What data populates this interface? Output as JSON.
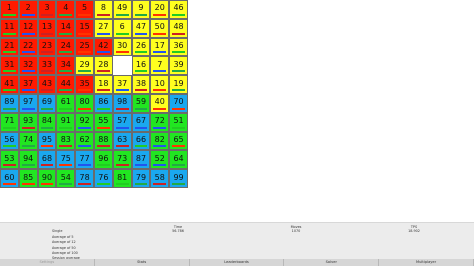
{
  "board": {
    "rows": [
      [
        1,
        2,
        3,
        4,
        5,
        8,
        49,
        9,
        20,
        46
      ],
      [
        11,
        12,
        13,
        14,
        15,
        27,
        6,
        47,
        50,
        48
      ],
      [
        21,
        22,
        23,
        24,
        25,
        "42",
        30,
        26,
        17,
        36
      ],
      [
        31,
        32,
        33,
        34,
        29,
        28,
        null,
        16,
        7,
        39
      ],
      [
        41,
        "37",
        43,
        44,
        "35",
        18,
        37,
        38,
        10,
        19
      ],
      [
        89,
        97,
        69,
        61,
        80,
        86,
        98,
        59,
        40,
        70
      ],
      [
        71,
        93,
        84,
        91,
        92,
        55,
        57,
        67,
        72,
        51
      ],
      [
        56,
        74,
        95,
        83,
        62,
        88,
        63,
        66,
        82,
        65
      ],
      [
        53,
        94,
        68,
        75,
        77,
        96,
        73,
        87,
        52,
        64
      ],
      [
        60,
        85,
        90,
        54,
        78,
        76,
        81,
        79,
        58,
        99
      ]
    ],
    "cell_colors": [
      [
        "red",
        "red",
        "red",
        "red",
        "red",
        "yellow",
        "yellow",
        "yellow",
        "yellow",
        "yellow"
      ],
      [
        "red",
        "red",
        "red",
        "red",
        "red",
        "yellow",
        "yellow",
        "yellow",
        "yellow",
        "yellow"
      ],
      [
        "red",
        "red",
        "red",
        "red",
        "red",
        "red",
        "yellow",
        "yellow",
        "yellow",
        "yellow"
      ],
      [
        "red",
        "red",
        "red",
        "red",
        "yellow",
        "yellow",
        "blank",
        "yellow",
        "yellow",
        "yellow"
      ],
      [
        "red",
        "red",
        "red",
        "red",
        "red",
        "yellow",
        "yellow",
        "yellow",
        "yellow",
        "yellow"
      ],
      [
        "blue",
        "blue",
        "blue",
        "green",
        "green",
        "blue",
        "blue",
        "green",
        "yellow",
        "blue"
      ],
      [
        "green",
        "green",
        "green",
        "green",
        "green",
        "green",
        "blue",
        "blue",
        "green",
        "green"
      ],
      [
        "blue",
        "green",
        "blue",
        "green",
        "green",
        "green",
        "blue",
        "blue",
        "green",
        "green"
      ],
      [
        "green",
        "green",
        "blue",
        "blue",
        "blue",
        "green",
        "green",
        "blue",
        "green",
        "green"
      ],
      [
        "blue",
        "green",
        "green",
        "green",
        "blue",
        "blue",
        "green",
        "blue",
        "blue",
        "blue"
      ]
    ],
    "colors": {
      "red": "#ff1a00",
      "yellow": "#ffff1f",
      "green": "#21e621",
      "blue": "#1aa8ef",
      "blank": "#ffffff",
      "underline": [
        "#ff3300",
        "#22cc22",
        "#2255ee",
        "#cc2222",
        "#22aa44"
      ]
    }
  },
  "stats": {
    "headers": [
      "Time",
      "Moves",
      "TPS"
    ],
    "rows": [
      "Single",
      "Average of 5",
      "Average of 12",
      "Average of 50",
      "Average of 100",
      "Session average"
    ],
    "single_values": [
      "56.786",
      "1070",
      "18.902"
    ]
  },
  "tabs": [
    "Settings",
    "Stats",
    "Leaderboards",
    "Solver",
    "Multiplayer"
  ]
}
